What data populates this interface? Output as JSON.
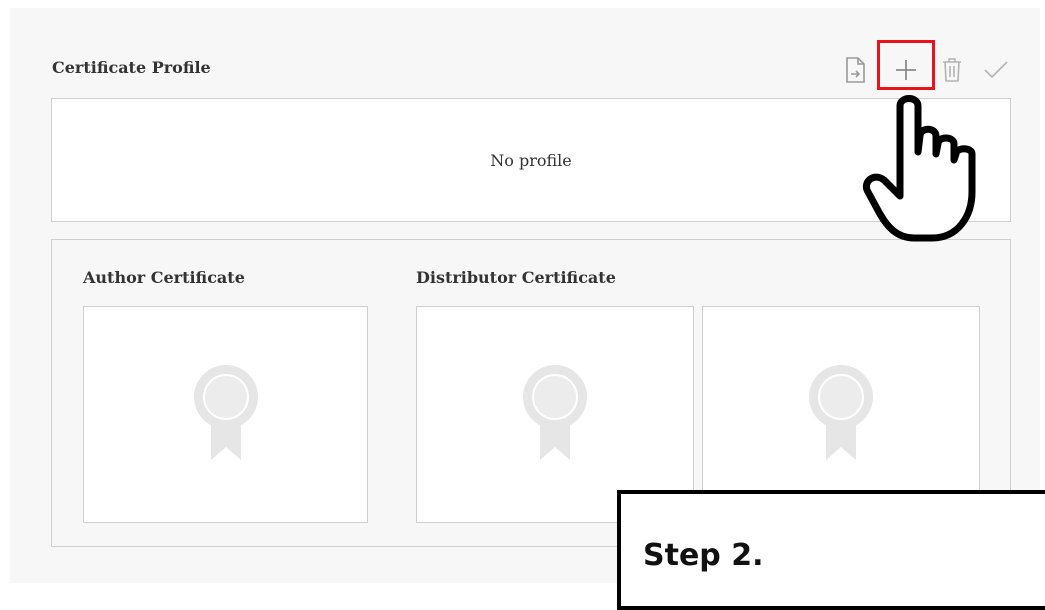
{
  "section": {
    "title": "Certificate Profile",
    "empty_message": "No profile"
  },
  "toolbar": {
    "icons": [
      "import-file-icon",
      "plus-icon",
      "trash-icon",
      "check-icon"
    ],
    "highlight_color": "#e8141b"
  },
  "certificates": {
    "author_label": "Author Certificate",
    "distributor_label": "Distributor Certificate",
    "badge_icon": "award-ribbon-icon"
  },
  "callout": {
    "text": "Step 2."
  },
  "colors": {
    "panel_bg": "#f7f7f7",
    "border": "#cfcfcf",
    "icon_gray": "#9a9a9a",
    "badge_gray": "#e6e6e6"
  }
}
